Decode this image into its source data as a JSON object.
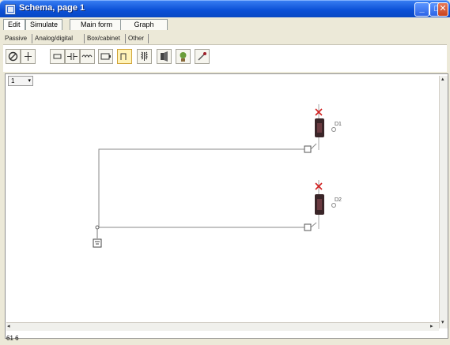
{
  "window": {
    "title": "Schema, page 1",
    "controls": {
      "minimize": "_",
      "maximize": "□",
      "close": "✕"
    }
  },
  "tabs_main": [
    "Edit",
    "Simulate",
    "Main form",
    "Graph"
  ],
  "tabs_sub": [
    "Passive",
    "Analog/digital",
    "Box/cabinet",
    "Other"
  ],
  "toolbar_icons": [
    "no-entry-icon",
    "ground-icon",
    "resistor-icon",
    "capacitor-icon",
    "inductor-icon",
    "battery-icon",
    "switch-icon",
    "transformer-icon",
    "speaker-icon",
    "lamp-icon",
    "probe-icon"
  ],
  "canvas": {
    "zoom": "1",
    "labels": {
      "d1": "D1",
      "d2": "D2"
    }
  },
  "status": {
    "coords": "61 6"
  }
}
